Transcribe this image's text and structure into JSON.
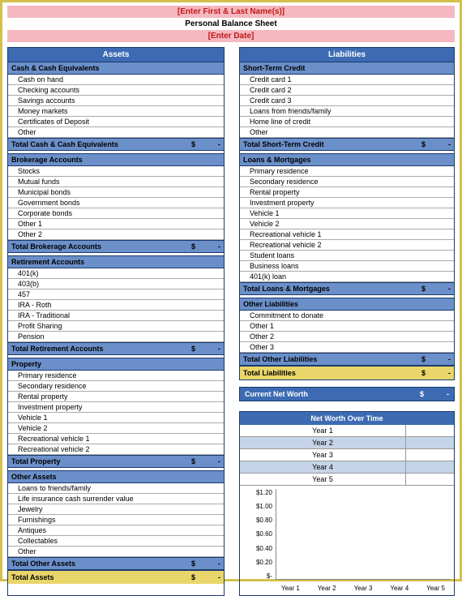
{
  "header": {
    "name_placeholder": "[Enter First & Last Name(s)]",
    "title": "Personal Balance Sheet",
    "date_placeholder": "[Enter Date]"
  },
  "assets": {
    "title": "Assets",
    "sections": [
      {
        "header": "Cash & Cash Equivalents",
        "items": [
          "Cash on hand",
          "Checking accounts",
          "Savings accounts",
          "Money markets",
          "Certificates of Deposit",
          "Other"
        ],
        "total_label": "Total Cash & Cash Equivalents",
        "total_sym": "$",
        "total_val": "-"
      },
      {
        "header": "Brokerage Accounts",
        "items": [
          "Stocks",
          "Mutual funds",
          "Municipal bonds",
          "Government bonds",
          "Corporate bonds",
          "Other 1",
          "Other 2"
        ],
        "total_label": "Total Brokerage Accounts",
        "total_sym": "$",
        "total_val": "-"
      },
      {
        "header": "Retirement Accounts",
        "items": [
          "401(k)",
          "403(b)",
          "457",
          "IRA - Roth",
          "IRA - Traditional",
          "Profit Sharing",
          "Pension"
        ],
        "total_label": "Total Retirement Accounts",
        "total_sym": "$",
        "total_val": "-"
      },
      {
        "header": "Property",
        "items": [
          "Primary residence",
          "Secondary residence",
          "Rental property",
          "Investment property",
          "Vehicle 1",
          "Vehicle 2",
          "Recreational vehicle 1",
          "Recreational vehicle 2"
        ],
        "total_label": "Total Property",
        "total_sym": "$",
        "total_val": "-"
      },
      {
        "header": "Other Assets",
        "items": [
          "Loans to friends/family",
          "Life insurance cash surrender value",
          "Jewelry",
          "Furnishings",
          "Antiques",
          "Collectables",
          "Other"
        ],
        "total_label": "Total Other Assets",
        "total_sym": "$",
        "total_val": "-"
      }
    ],
    "grand_total": {
      "label": "Total Assets",
      "sym": "$",
      "val": "-"
    }
  },
  "liabilities": {
    "title": "Liabilities",
    "sections": [
      {
        "header": "Short-Term Credit",
        "items": [
          "Credit card 1",
          "Credit card 2",
          "Credit card 3",
          "Loans from friends/family",
          "Home line of credit",
          "Other"
        ],
        "total_label": "Total Short-Term Credit",
        "total_sym": "$",
        "total_val": "-"
      },
      {
        "header": "Loans & Mortgages",
        "items": [
          "Primary residence",
          "Secondary residence",
          "Rental property",
          "Investment property",
          "Vehicle 1",
          "Vehicle 2",
          "Recreational vehicle 1",
          "Recreational vehicle 2",
          "Student loans",
          "Business loans",
          "401(k) loan"
        ],
        "total_label": "Total Loans & Mortgages",
        "total_sym": "$",
        "total_val": "-"
      },
      {
        "header": "Other Liabilities",
        "items": [
          "Commitment to donate",
          "Other 1",
          "Other 2",
          "Other 3"
        ],
        "total_label": "Total Other Liabilities",
        "total_sym": "$",
        "total_val": "-"
      }
    ],
    "grand_total": {
      "label": "Total Liabilities",
      "sym": "$",
      "val": "-"
    }
  },
  "networth": {
    "label": "Current Net Worth",
    "sym": "$",
    "val": "-"
  },
  "chart": {
    "title": "Net Worth Over Time",
    "years": [
      "Year 1",
      "Year 2",
      "Year 3",
      "Year 4",
      "Year 5"
    ]
  },
  "chart_data": {
    "type": "bar",
    "title": "Net Worth Over Time",
    "categories": [
      "Year 1",
      "Year 2",
      "Year 3",
      "Year 4",
      "Year 5"
    ],
    "values": [
      null,
      null,
      null,
      null,
      null
    ],
    "xlabel": "",
    "ylabel": "",
    "ylim": [
      0,
      1.2
    ],
    "yticks": [
      "$1.20",
      "$1.00",
      "$0.80",
      "$0.60",
      "$0.40",
      "$0.20",
      "$-"
    ]
  }
}
